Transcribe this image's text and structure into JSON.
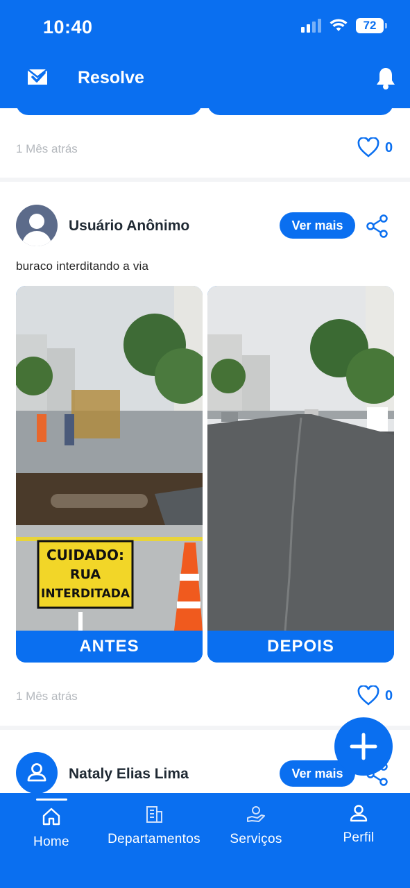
{
  "status_bar": {
    "time": "10:40",
    "battery": "72"
  },
  "app": {
    "name": "Resolve"
  },
  "colors": {
    "primary": "#0a6ff0",
    "muted": "#b4b8bd"
  },
  "previous_post": {
    "time_ago": "1 Mês atrás",
    "likes": "0"
  },
  "post": {
    "user_name": "Usuário Anônimo",
    "ver_mais_label": "Ver mais",
    "text": "buraco interditando a via",
    "before_label": "ANTES",
    "after_label": "DEPOIS",
    "sign_text_1": "CUIDADO:",
    "sign_text_2": "RUA",
    "sign_text_3": "INTERDITADA",
    "time_ago": "1 Mês atrás",
    "likes": "0"
  },
  "next_post": {
    "user_name": "Nataly Elias Lima",
    "ver_mais_label": "Ver mais"
  },
  "bottom_nav": {
    "home": "Home",
    "departamentos": "Departamentos",
    "servicos": "Serviços",
    "perfil": "Perfil"
  },
  "icons": [
    "wifi-icon",
    "signal-icon",
    "battery-icon",
    "app-logo-icon",
    "bell-icon",
    "heart-icon",
    "share-icon",
    "plus-icon",
    "home-icon",
    "building-icon",
    "services-icon",
    "person-icon"
  ]
}
